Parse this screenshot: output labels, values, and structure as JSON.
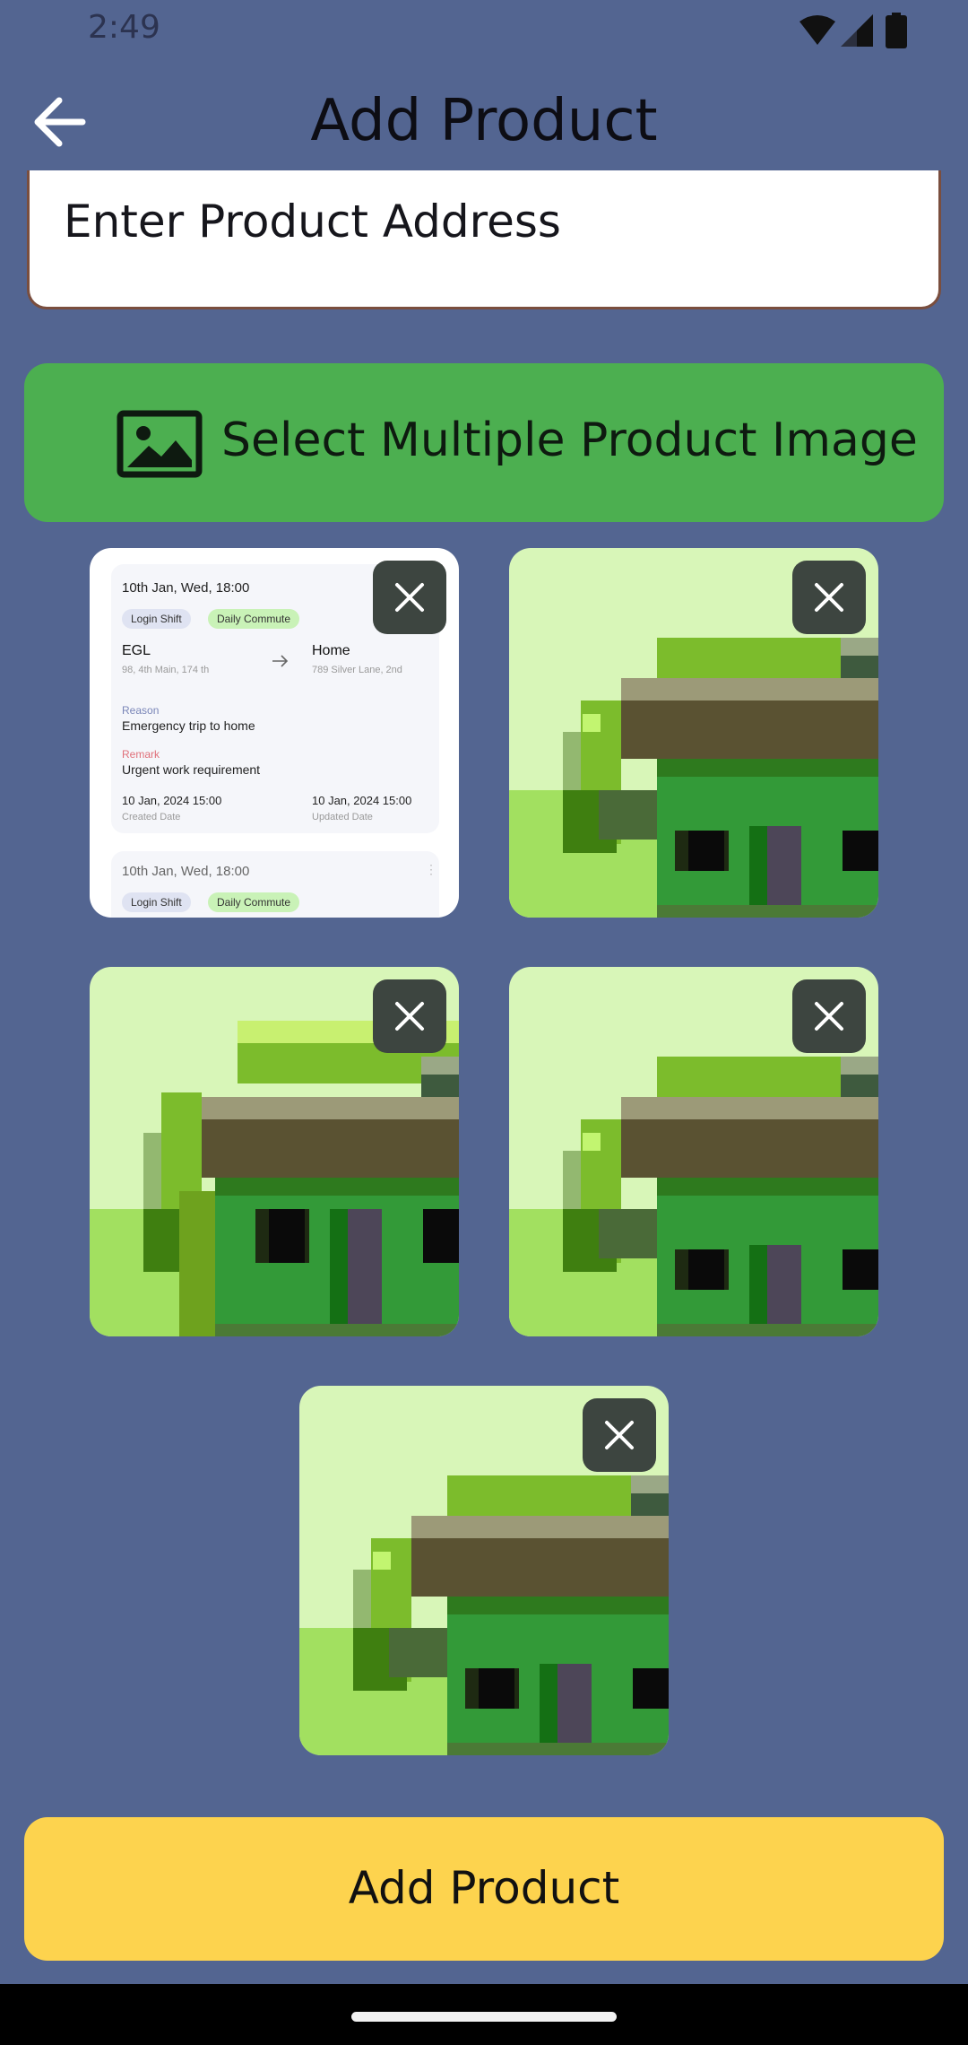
{
  "status_bar": {
    "time": "2:49",
    "icons": [
      "wifi-icon",
      "signal-icon",
      "battery-icon"
    ]
  },
  "app_bar": {
    "title": "Add Product",
    "back_icon": "arrow-left-icon"
  },
  "address_field": {
    "placeholder": "Enter Product Address"
  },
  "select_images_button": {
    "label": "Select Multiple Product Image",
    "icon": "image-icon"
  },
  "selected_images": {
    "screenshot_thumb": {
      "cards": [
        {
          "datetime": "10th Jan, Wed, 18:00",
          "chips": [
            "Login Shift",
            "Daily Commute"
          ],
          "from_title": "EGL",
          "from_address": "98, 4th Main, 174 th",
          "to_title": "Home",
          "to_address": "789 Silver Lane, 2nd",
          "reason_label": "Reason",
          "reason": "Emergency trip to home",
          "remark_label": "Remark",
          "remark": "Urgent work requirement",
          "created_value": "10 Jan, 2024  15:00",
          "created_label": "Created Date",
          "updated_value": "10 Jan, 2024  15:00",
          "updated_label": "Updated Date"
        },
        {
          "datetime": "10th Jan, Wed, 18:00",
          "chips": [
            "Login Shift",
            "Daily Commute"
          ]
        }
      ]
    },
    "pixel_house_count": 4,
    "remove_icon": "close-icon"
  },
  "add_product_button": {
    "label": "Add Product"
  },
  "colors": {
    "background": "#536591",
    "select_button": "#4caf50",
    "add_button": "#fdd34e",
    "remove_button": "#3d4540"
  }
}
